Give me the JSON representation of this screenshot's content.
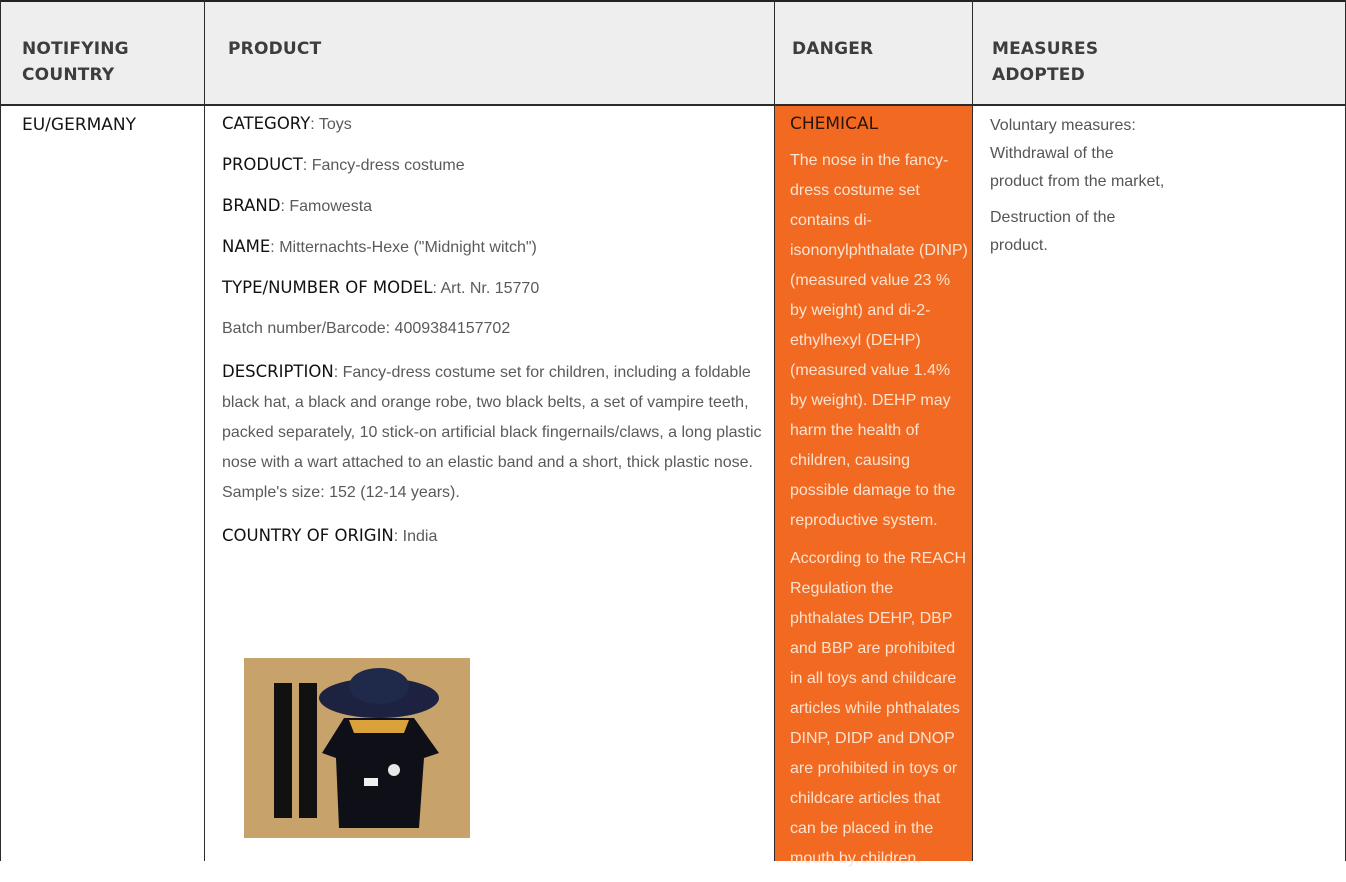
{
  "headers": {
    "country": "NOTIFYING\nCOUNTRY",
    "product": "PRODUCT",
    "danger": "DANGER",
    "measures": "MEASURES\nADOPTED"
  },
  "row": {
    "country": "EU/GERMANY",
    "category": {
      "label": "CATEGORY",
      "value": ": Toys"
    },
    "product": {
      "label": "PRODUCT",
      "value": ": Fancy-dress costume"
    },
    "brand": {
      "label": "BRAND",
      "value": ": Famowesta"
    },
    "name": {
      "label": "NAME",
      "value": ": Mitternachts-Hexe (\"Midnight witch\")"
    },
    "model": {
      "label": "TYPE/NUMBER OF MODEL",
      "value": ": Art. Nr. 15770"
    },
    "batch": "Batch number/Barcode: 4009384157702",
    "description": {
      "label": "DESCRIPTION",
      "value": ": Fancy-dress costume set for children, including a foldable black hat, a black and orange robe, two black belts, a set of vampire teeth, packed separately, 10 stick-on artificial black fingernails/claws, a long plastic nose with a wart attached to an elastic band and a short, thick plastic nose. Sample's size: 152 (12-14 years)."
    },
    "origin": {
      "label": "COUNTRY OF ORIGIN",
      "value": ": India"
    },
    "danger_title": "CHEMICAL",
    "danger_p1": "The nose in the fancy-dress costume set contains di-isononylphthalate (DINP) (measured value 23 % by weight) and di-2-ethylhexyl (DEHP) (measured value 1.4% by weight). DEHP may harm the health of children, causing possible damage to the reproductive system.",
    "danger_p2": "According to the REACH Regulation the phthalates DEHP, DBP and BBP are prohibited in all toys and childcare articles while phthalates DINP, DIDP and DNOP are prohibited in toys or childcare articles that can be placed in the mouth by children.",
    "measures_p1": "Voluntary measures: Withdrawal of the product from the market,",
    "measures_p2": "Destruction of the product."
  },
  "colors": {
    "header_bg": "#eeeeee",
    "danger_bg": "#f26a22",
    "danger_text": "#fde2cf"
  }
}
